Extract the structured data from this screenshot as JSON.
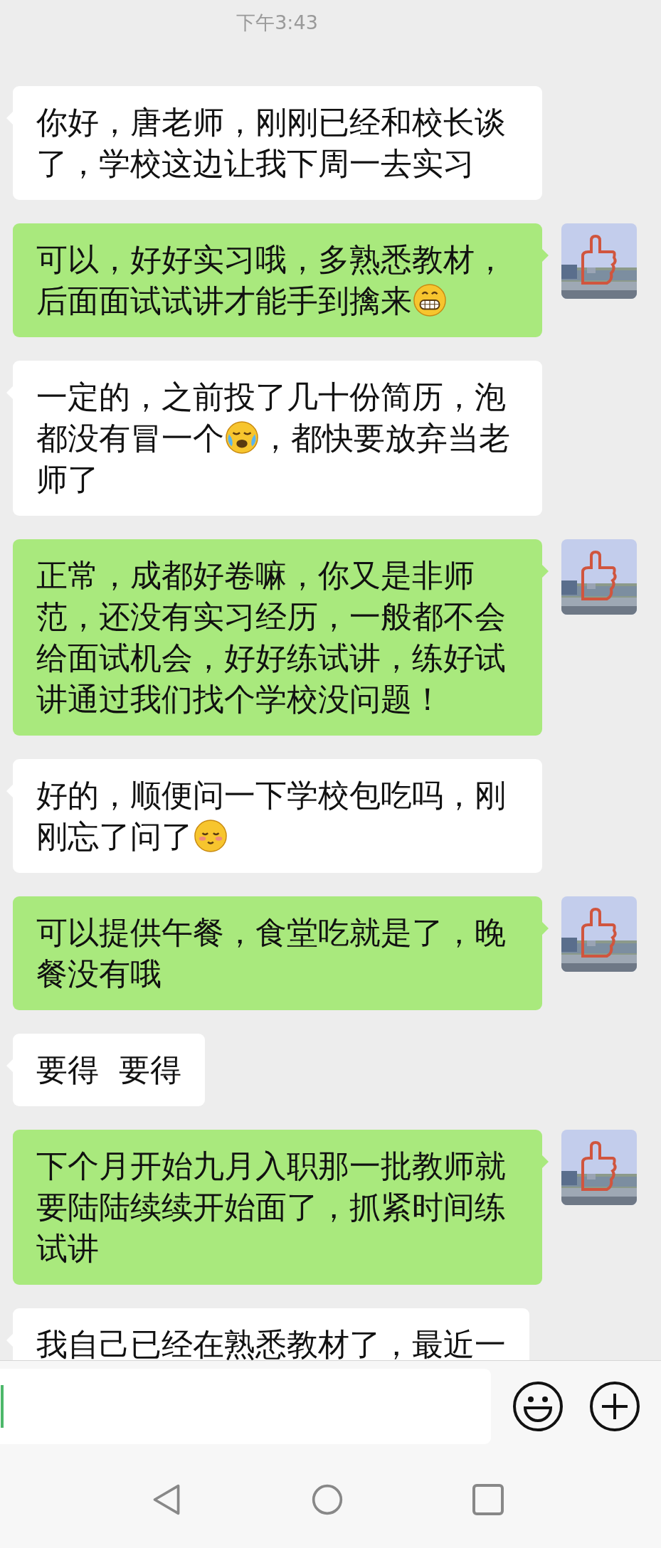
{
  "time": "下午3:43",
  "messages": [
    {
      "kind": "received",
      "parts": [
        {
          "kind": "text",
          "text": "你好，唐老师，刚刚已经和校长谈了，学校这边让我下周一去实习"
        }
      ]
    },
    {
      "kind": "sent",
      "avatar": {
        "kind": "picture"
      },
      "parts": [
        {
          "kind": "text",
          "text": "可以，好好实习哦，多熟悉教材，后面面试试讲才能手到擒来"
        },
        {
          "kind": "grin"
        }
      ]
    },
    {
      "kind": "received",
      "parts": [
        {
          "kind": "text",
          "text": "一定的，之前投了几十份简历，泡都没有冒一个"
        },
        {
          "kind": "cry"
        },
        {
          "kind": "text",
          "text": "，都快要放弃当老师了"
        }
      ]
    },
    {
      "kind": "sent",
      "avatar": {
        "kind": "picture"
      },
      "parts": [
        {
          "kind": "text",
          "text": "正常，成都好卷嘛，你又是非师范，还没有实习经历，一般都不会给面试机会，好好练试讲，练好试讲通过我们找个学校没问题！"
        }
      ]
    },
    {
      "kind": "received",
      "parts": [
        {
          "kind": "text",
          "text": "好的，顺便问一下学校包吃吗，刚刚忘了问了"
        },
        {
          "kind": "blush"
        }
      ]
    },
    {
      "kind": "sent",
      "avatar": {
        "kind": "picture"
      },
      "parts": [
        {
          "kind": "text",
          "text": "可以提供午餐，食堂吃就是了，晚餐没有哦"
        }
      ]
    },
    {
      "kind": "received",
      "parts": [
        {
          "kind": "text",
          "text": "要得  要得"
        }
      ]
    },
    {
      "kind": "sent",
      "avatar": {
        "kind": "picture"
      },
      "parts": [
        {
          "kind": "text",
          "text": "下个月开始九月入职那一批教师就要陆陆续续开始面了，抓紧时间练试讲"
        }
      ]
    },
    {
      "kind": "received",
      "parts": [
        {
          "kind": "text",
          "text": "我自己已经在熟悉教材了，最近一"
        }
      ]
    }
  ],
  "input": {
    "kind": "empty"
  }
}
